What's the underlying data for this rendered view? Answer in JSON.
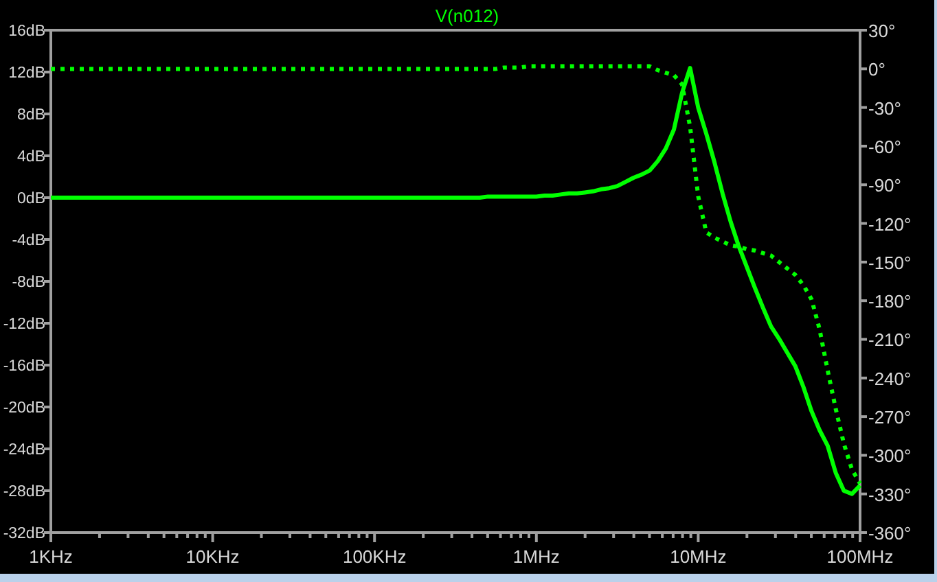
{
  "plot": {
    "chart_data": {
      "type": "line",
      "title": "V(n012)",
      "categories": [
        "1KHz",
        null,
        null,
        null,
        null,
        null,
        null,
        null,
        null,
        null,
        null,
        null,
        null,
        null,
        null,
        null,
        null,
        null,
        null,
        null,
        "10KHz",
        null,
        null,
        null,
        null,
        null,
        null,
        null,
        null,
        null,
        null,
        null,
        null,
        null,
        null,
        null,
        null,
        null,
        null,
        null,
        "100KHz",
        null,
        null,
        null,
        null,
        null,
        null,
        null,
        null,
        null,
        null,
        null,
        null,
        null,
        null,
        null,
        null,
        null,
        null,
        null,
        "1MHz",
        null,
        null,
        null,
        null,
        null,
        null,
        null,
        null,
        null,
        null,
        null,
        null,
        null,
        null,
        null,
        null,
        null,
        null,
        null,
        "10MHz",
        null,
        null,
        null,
        null,
        null,
        null,
        null,
        null,
        null,
        null,
        null,
        null,
        null,
        null,
        null,
        null,
        null,
        null,
        null,
        "100MHz"
      ],
      "series": [
        {
          "color": "#00ff00",
          "line_style": "solid",
          "values": [
            0,
            0,
            0,
            0,
            0,
            0,
            0,
            0,
            0,
            0,
            0,
            0,
            0,
            0,
            0,
            0,
            0,
            0,
            0,
            0,
            0,
            0,
            0,
            0,
            0,
            0,
            0,
            0,
            0,
            0,
            0,
            0,
            0,
            0,
            0,
            0,
            0,
            0,
            0,
            0,
            0,
            0,
            0,
            0,
            0,
            0,
            0,
            0,
            0,
            0,
            0,
            0,
            0,
            0,
            0.1,
            0.1,
            0.1,
            0.1,
            0.1,
            0.1,
            0.1,
            0.2,
            0.2,
            0.3,
            0.4,
            0.4,
            0.5,
            0.6,
            0.8,
            0.9,
            1.1,
            1.5,
            1.9,
            2.2,
            2.6,
            3.5,
            4.7,
            6.5,
            10,
            12.4,
            8.6,
            6.1,
            3.4,
            0.4,
            -2.3,
            -4.6,
            -6.6,
            -8.6,
            -10.5,
            -12.3,
            -13.5,
            -14.8,
            -16.1,
            -18.1,
            -20.4,
            -22.2,
            -23.7,
            -26.3,
            -28,
            -28.3,
            -27.5
          ]
        },
        {
          "color": "#00ff00",
          "axis": "y2",
          "line_style": "dotted",
          "values": [
            0,
            0,
            0,
            0,
            0,
            0,
            0,
            0,
            0,
            0,
            0,
            0,
            0,
            0,
            0,
            0,
            0,
            0,
            0,
            0,
            0,
            0,
            0,
            0,
            0,
            0,
            0,
            0,
            0,
            0,
            0,
            0,
            0,
            0,
            0,
            0,
            0,
            0,
            0,
            0,
            0,
            0,
            0,
            0,
            0,
            0,
            0,
            0,
            0,
            0,
            0,
            0,
            0,
            0,
            0,
            0,
            1,
            1,
            1,
            2,
            2,
            2,
            2,
            2,
            2,
            2,
            2,
            2,
            2,
            2,
            2,
            2,
            2,
            2,
            2,
            -1,
            -3,
            -5,
            -12,
            -45,
            -99,
            -127,
            -131,
            -134,
            -137,
            -138,
            -140,
            -141,
            -143,
            -145,
            -150,
            -155,
            -160,
            -168,
            -179,
            -202,
            -234,
            -264,
            -291,
            -311,
            -322
          ]
        }
      ],
      "ylim": [
        -32,
        16
      ],
      "y2lim": [
        -360,
        30
      ],
      "yticks": [
        {
          "value": 16,
          "label": "16dB"
        },
        {
          "value": 12,
          "label": "12dB"
        },
        {
          "value": 8,
          "label": "8dB"
        },
        {
          "value": 4,
          "label": "4dB"
        },
        {
          "value": 0,
          "label": "0dB"
        },
        {
          "value": -4,
          "label": "-4dB"
        },
        {
          "value": -8,
          "label": "-8dB"
        },
        {
          "value": -12,
          "label": "-12dB"
        },
        {
          "value": -16,
          "label": "-16dB"
        },
        {
          "value": -20,
          "label": "-20dB"
        },
        {
          "value": -24,
          "label": "-24dB"
        },
        {
          "value": -28,
          "label": "-28dB"
        },
        {
          "value": -32,
          "label": "-32dB"
        }
      ],
      "y2ticks": [
        {
          "value": 30,
          "label": "30°"
        },
        {
          "value": 0,
          "label": "0°"
        },
        {
          "value": -30,
          "label": "-30°"
        },
        {
          "value": -60,
          "label": "-60°"
        },
        {
          "value": -90,
          "label": "-90°"
        },
        {
          "value": -120,
          "label": "-120°"
        },
        {
          "value": -150,
          "label": "-150°"
        },
        {
          "value": -180,
          "label": "-180°"
        },
        {
          "value": -210,
          "label": "-210°"
        },
        {
          "value": -240,
          "label": "-240°"
        },
        {
          "value": -270,
          "label": "-270°"
        },
        {
          "value": -300,
          "label": "-300°"
        },
        {
          "value": -330,
          "label": "-330°"
        },
        {
          "value": -360,
          "label": "-360°"
        }
      ]
    }
  }
}
